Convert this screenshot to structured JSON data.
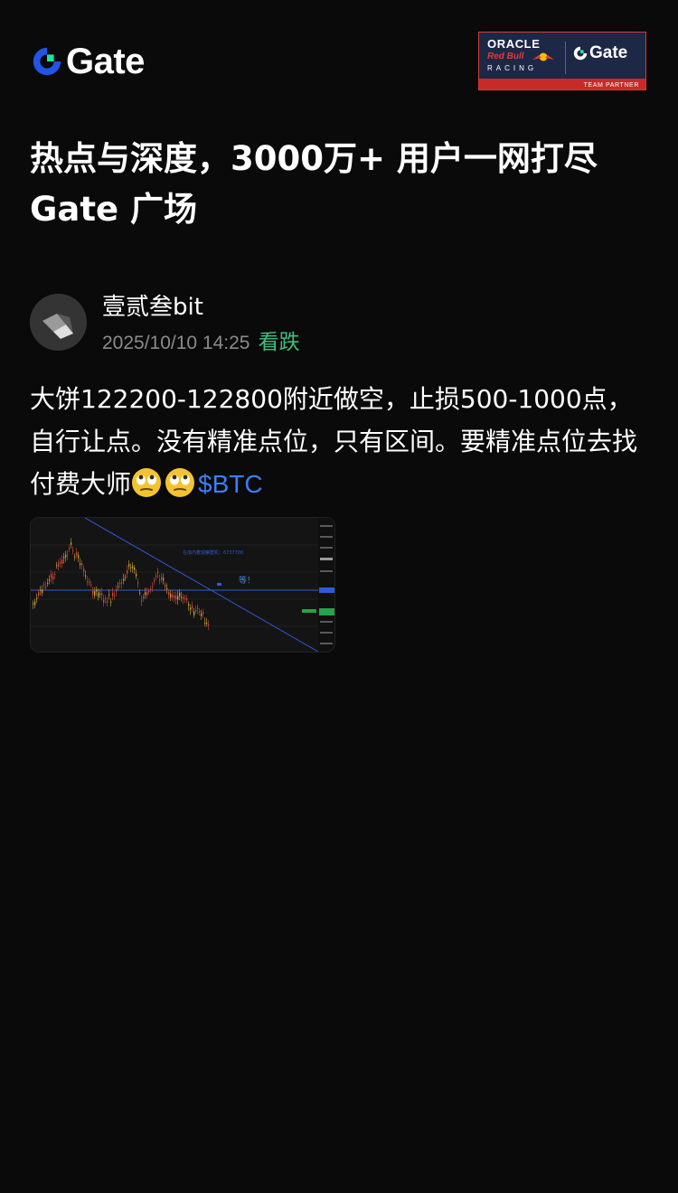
{
  "header": {
    "logo_text": "Gate",
    "partner": {
      "oracle": "ORACLE",
      "red_bull": "Red Bull",
      "racing": "RACING",
      "brand": "Gate",
      "strip": "TEAM PARTNER"
    }
  },
  "headline": {
    "line1": "热点与深度，3000万+ 用户一网打尽",
    "line2": "Gate 广场"
  },
  "post": {
    "author": "壹贰叁bit",
    "time": "2025/10/10 14:25",
    "sentiment": "看跌",
    "text": "大饼122200-122800附近做空，止损500-1000点，自行让点。没有精准点位，只有区间。要精准点位去找付费大师",
    "emoji": "face-with-rolling-eyes",
    "ticker": "$BTC"
  },
  "chart_thumbnail": {
    "watermark": "在加内着观察群机：6737700",
    "annotation": "等！"
  },
  "colors": {
    "background": "#0a0a0a",
    "bearish_tag": "#3fbf7f",
    "link": "#3b7ff5",
    "brand_blue": "#2354e6",
    "brand_green": "#17e6a1"
  }
}
